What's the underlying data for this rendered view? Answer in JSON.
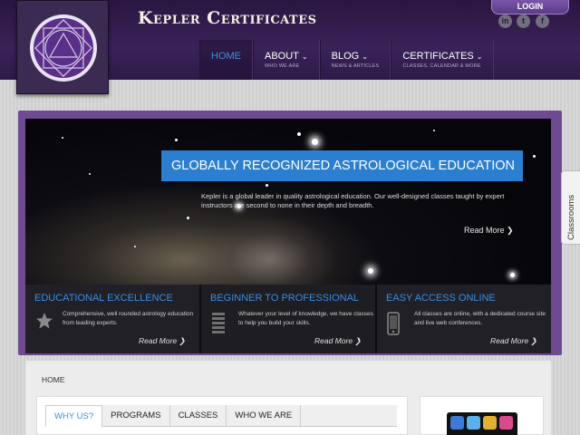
{
  "header": {
    "site_title": "Kepler Certificates",
    "login_label": "LOGIN",
    "social": [
      {
        "icon": "linkedin-icon",
        "glyph": "in"
      },
      {
        "icon": "twitter-icon",
        "glyph": "t"
      },
      {
        "icon": "facebook-icon",
        "glyph": "f"
      }
    ]
  },
  "nav": [
    {
      "label": "HOME",
      "sub": "",
      "active": true
    },
    {
      "label": "ABOUT",
      "sub": "WHO WE ARE",
      "chevron": "⌄"
    },
    {
      "label": "BLOG",
      "sub": "NEWS & ARTICLES",
      "chevron": "⌄"
    },
    {
      "label": "CERTIFICATES",
      "sub": "CLASSES, CALENDAR & MORE",
      "chevron": "⌄"
    }
  ],
  "hero": {
    "title": "GLOBALLY RECOGNIZED ASTROLOGICAL EDUCATION",
    "description": "Kepler is a global leader in quality astrological education. Our well-designed classes taught by expert instructors are second to none in their depth and breadth.",
    "more_label": "Read More ❯"
  },
  "features": [
    {
      "title": "EDUCATIONAL EXCELLENCE",
      "text": "Comprehensive, well rounded astrology education from leading experts.",
      "more_label": "Read More ❯",
      "icon": "star-icon"
    },
    {
      "title": "BEGINNER TO PROFESSIONAL",
      "text": "Whatever your level of knowledge, we have classes to help you build your skills.",
      "more_label": "Read More ❯",
      "icon": "levels-icon"
    },
    {
      "title": "EASY ACCESS ONLINE",
      "text": "All classes are online, with a dedicated course site and live web conferences.",
      "more_label": "Read More ❯",
      "icon": "phone-icon"
    }
  ],
  "side_tab": {
    "label": "Classrooms"
  },
  "breadcrumb": "HOME",
  "tabs": [
    {
      "label": "WHY US?",
      "active": true
    },
    {
      "label": "PROGRAMS"
    },
    {
      "label": "CLASSES"
    },
    {
      "label": "WHO WE ARE"
    }
  ],
  "colors": {
    "accent": "#2a7fd0",
    "header_purple": "#3a2258",
    "frame_purple": "#6e4a92"
  }
}
